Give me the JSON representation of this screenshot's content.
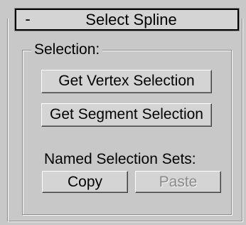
{
  "rollout": {
    "collapse_symbol": "-",
    "title": "Select Spline"
  },
  "selection_group": {
    "label": "Selection:",
    "get_vertex_label": "Get Vertex Selection",
    "get_segment_label": "Get Segment Selection",
    "named_sets_label": "Named Selection Sets:",
    "copy_label": "Copy",
    "paste_label": "Paste"
  },
  "colors": {
    "panel_background": "#c8c8c8",
    "disabled_text": "#8a8a8a"
  }
}
